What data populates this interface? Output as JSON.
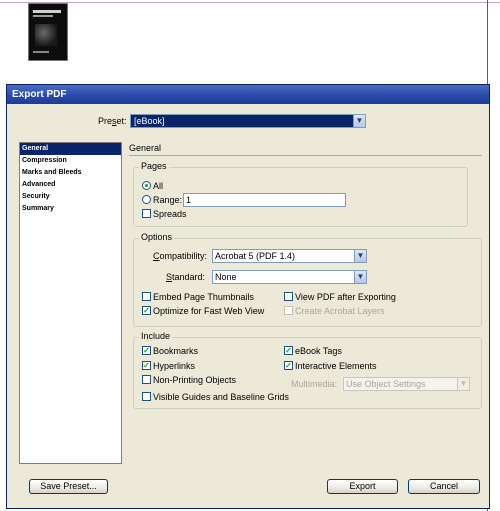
{
  "dialog": {
    "title": "Export PDF",
    "preset_label": "Preset:",
    "preset_value": "[eBook]",
    "nav": [
      "General",
      "Compression",
      "Marks and Bleeds",
      "Advanced",
      "Security",
      "Summary"
    ],
    "panel_title": "General",
    "pages": {
      "legend": "Pages",
      "all_label": "All",
      "range_label": "Range:",
      "range_value": "1",
      "spreads_label": "Spreads"
    },
    "options": {
      "legend": "Options",
      "compat_label": "Compatibility:",
      "compat_value": "Acrobat 5 (PDF 1.4)",
      "standard_label": "Standard:",
      "standard_value": "None",
      "embed_thumbs": "Embed Page Thumbnails",
      "view_pdf": "View PDF after Exporting",
      "optimize": "Optimize for Fast Web View",
      "create_layers": "Create Acrobat Layers"
    },
    "include": {
      "legend": "Include",
      "bookmarks": "Bookmarks",
      "ebook_tags": "eBook Tags",
      "hyperlinks": "Hyperlinks",
      "interactive": "Interactive Elements",
      "non_printing": "Non-Printing Objects",
      "multimedia_label": "Multimedia:",
      "multimedia_value": "Use Object Settings",
      "visible_guides": "Visible Guides and Baseline Grids"
    },
    "buttons": {
      "save_preset": "Save Preset...",
      "export": "Export",
      "cancel": "Cancel"
    }
  },
  "checkmark": "✓",
  "colors": {
    "title_bar": "#2a4ba8",
    "dialog_bg": "#ece9d8",
    "selection": "#0a246a"
  }
}
